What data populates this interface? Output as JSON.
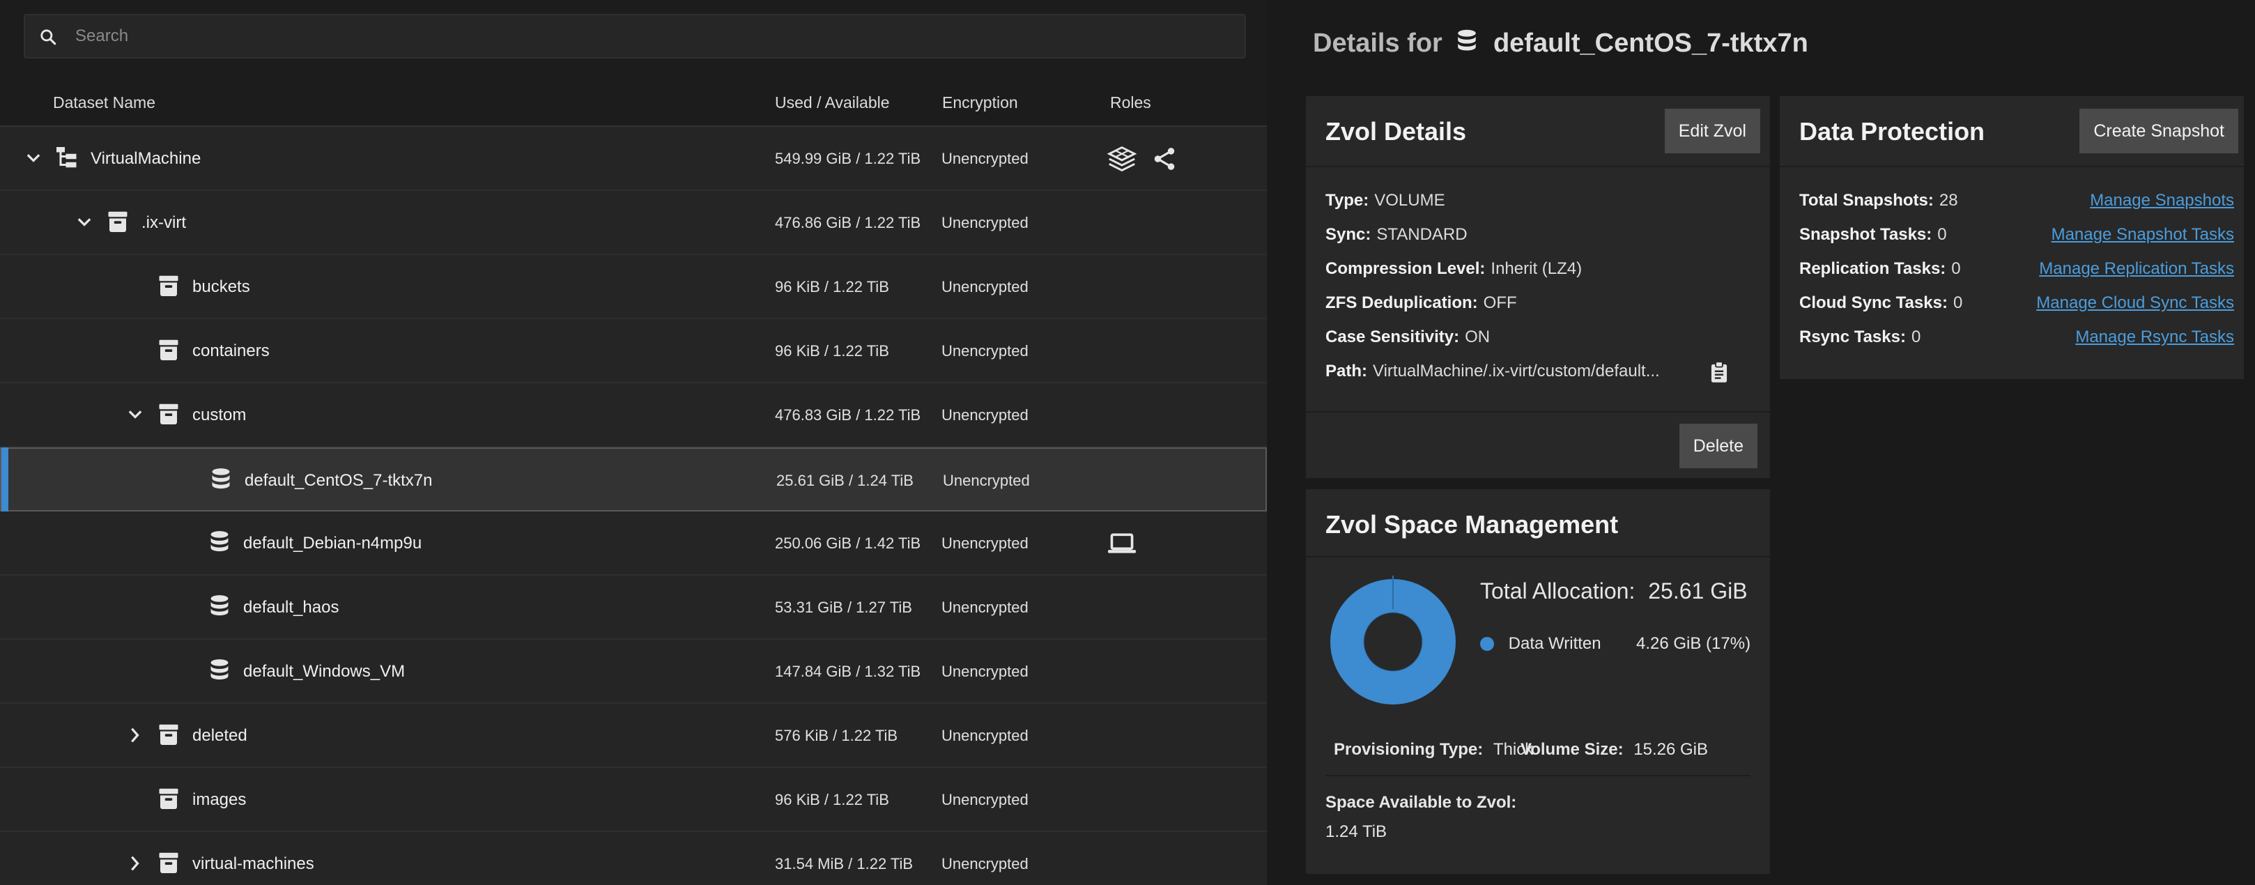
{
  "search": {
    "placeholder": "Search"
  },
  "columns": {
    "name": "Dataset Name",
    "used": "Used / Available",
    "encryption": "Encryption",
    "roles": "Roles"
  },
  "rows": [
    {
      "name": "VirtualMachine",
      "used": "549.99 GiB / 1.22 TiB",
      "encryption": "Unencrypted",
      "icon": "pool-tree-icon",
      "expander": "expanded",
      "roles": [
        "apps-icon",
        "share-icon"
      ]
    },
    {
      "name": ".ix-virt",
      "used": "476.86 GiB / 1.22 TiB",
      "encryption": "Unencrypted",
      "icon": "dataset-icon",
      "expander": "expanded",
      "roles": []
    },
    {
      "name": "buckets",
      "used": "96 KiB / 1.22 TiB",
      "encryption": "Unencrypted",
      "icon": "dataset-icon",
      "expander": "none",
      "roles": []
    },
    {
      "name": "containers",
      "used": "96 KiB / 1.22 TiB",
      "encryption": "Unencrypted",
      "icon": "dataset-icon",
      "expander": "none",
      "roles": []
    },
    {
      "name": "custom",
      "used": "476.83 GiB / 1.22 TiB",
      "encryption": "Unencrypted",
      "icon": "dataset-icon",
      "expander": "expanded",
      "roles": []
    },
    {
      "name": "default_CentOS_7-tktx7n",
      "used": "25.61 GiB / 1.24 TiB",
      "encryption": "Unencrypted",
      "icon": "zvol-icon",
      "expander": "none",
      "roles": []
    },
    {
      "name": "default_Debian-n4mp9u",
      "used": "250.06 GiB / 1.42 TiB",
      "encryption": "Unencrypted",
      "icon": "zvol-icon",
      "expander": "none",
      "roles": [
        "vm-laptop-icon"
      ]
    },
    {
      "name": "default_haos",
      "used": "53.31 GiB / 1.27 TiB",
      "encryption": "Unencrypted",
      "icon": "zvol-icon",
      "expander": "none",
      "roles": []
    },
    {
      "name": "default_Windows_VM",
      "used": "147.84 GiB / 1.32 TiB",
      "encryption": "Unencrypted",
      "icon": "zvol-icon",
      "expander": "none",
      "roles": []
    },
    {
      "name": "deleted",
      "used": "576 KiB / 1.22 TiB",
      "encryption": "Unencrypted",
      "icon": "dataset-icon",
      "expander": "collapsed",
      "roles": []
    },
    {
      "name": "images",
      "used": "96 KiB / 1.22 TiB",
      "encryption": "Unencrypted",
      "icon": "dataset-icon",
      "expander": "none",
      "roles": []
    },
    {
      "name": "virtual-machines",
      "used": "31.54 MiB / 1.22 TiB",
      "encryption": "Unencrypted",
      "icon": "dataset-icon",
      "expander": "collapsed",
      "roles": []
    }
  ],
  "details": {
    "prefix": "Details for",
    "name": "default_CentOS_7-tktx7n"
  },
  "zvol_details": {
    "title": "Zvol Details",
    "edit_label": "Edit Zvol",
    "delete_label": "Delete",
    "fields": [
      {
        "key": "Type:",
        "value": "VOLUME"
      },
      {
        "key": "Sync:",
        "value": "STANDARD"
      },
      {
        "key": "Compression Level:",
        "value": "Inherit (LZ4)"
      },
      {
        "key": "ZFS Deduplication:",
        "value": "OFF"
      },
      {
        "key": "Case Sensitivity:",
        "value": "ON"
      },
      {
        "key": "Path:",
        "value": "VirtualMachine/.ix-virt/custom/default..."
      }
    ]
  },
  "data_protection": {
    "title": "Data Protection",
    "create_label": "Create Snapshot",
    "items": [
      {
        "key": "Total Snapshots:",
        "value": "28",
        "link": "Manage Snapshots"
      },
      {
        "key": "Snapshot Tasks:",
        "value": "0",
        "link": "Manage Snapshot Tasks"
      },
      {
        "key": "Replication Tasks:",
        "value": "0",
        "link": "Manage Replication Tasks"
      },
      {
        "key": "Cloud Sync Tasks:",
        "value": "0",
        "link": "Manage Cloud Sync Tasks"
      },
      {
        "key": "Rsync Tasks:",
        "value": "0",
        "link": "Manage Rsync Tasks"
      }
    ]
  },
  "space": {
    "title": "Zvol Space Management",
    "total_label": "Total Allocation:",
    "total_value": "25.61 GiB",
    "legend_label": "Data Written",
    "legend_value": "4.26 GiB (17%)",
    "written_fraction": 0.17,
    "written_color": "#3d8bd0",
    "provisioning_key": "Provisioning Type:",
    "provisioning_value": "Thick",
    "volume_key": "Volume Size:",
    "volume_value": "15.26 GiB",
    "available_key": "Space Available to Zvol:",
    "available_value": "1.24 TiB"
  }
}
